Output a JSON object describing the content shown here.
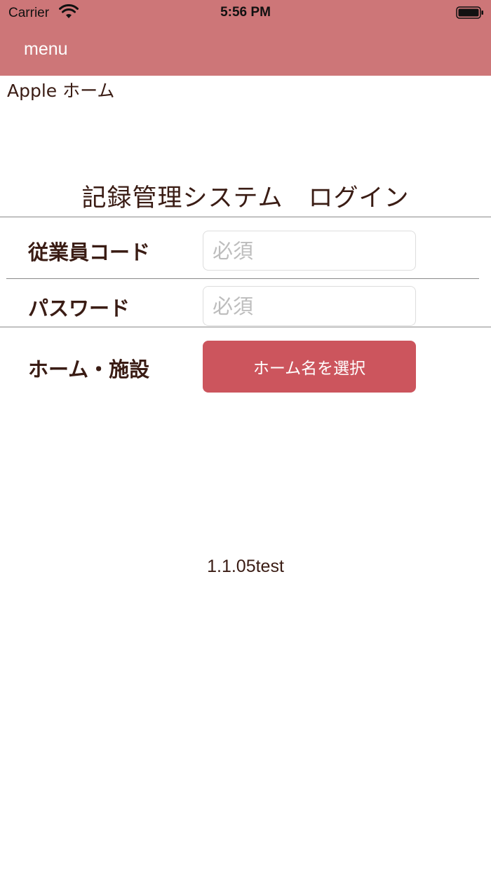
{
  "status_bar": {
    "carrier": "Carrier",
    "time": "5:56 PM"
  },
  "nav": {
    "menu_label": "menu"
  },
  "home_label": "Apple ホーム",
  "login": {
    "title": "記録管理システム　ログイン",
    "employee_code": {
      "label": "従業員コード",
      "placeholder": "必須",
      "value": ""
    },
    "password": {
      "label": "パスワード",
      "placeholder": "必須",
      "value": ""
    },
    "facility": {
      "label": "ホーム・施設",
      "button_label": "ホーム名を選択"
    }
  },
  "version": "1.1.05test",
  "colors": {
    "nav_background": "#cd7678",
    "button_background": "#cc555d",
    "text": "#3a1c14"
  },
  "icons": {
    "wifi": "wifi-icon",
    "battery": "battery-icon"
  }
}
